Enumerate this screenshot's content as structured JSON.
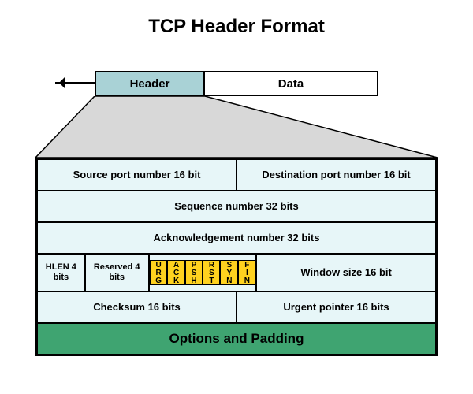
{
  "title": "TCP Header Format",
  "segment": {
    "header": "Header",
    "data": "Data"
  },
  "rows": {
    "src_port": "Source port number 16 bit",
    "dst_port": "Destination port number 16 bit",
    "seq": "Sequence number 32 bits",
    "ack": "Acknowledgement number 32 bits",
    "hlen": "HLEN 4 bits",
    "reserved": "Reserved 4 bits",
    "flags": [
      "URG",
      "ACK",
      "PSH",
      "RST",
      "SYN",
      "FIN"
    ],
    "window": "Window size 16 bit",
    "checksum": "Checksum 16 bits",
    "urgent": "Urgent pointer 16 bits",
    "options": "Options and Padding"
  }
}
